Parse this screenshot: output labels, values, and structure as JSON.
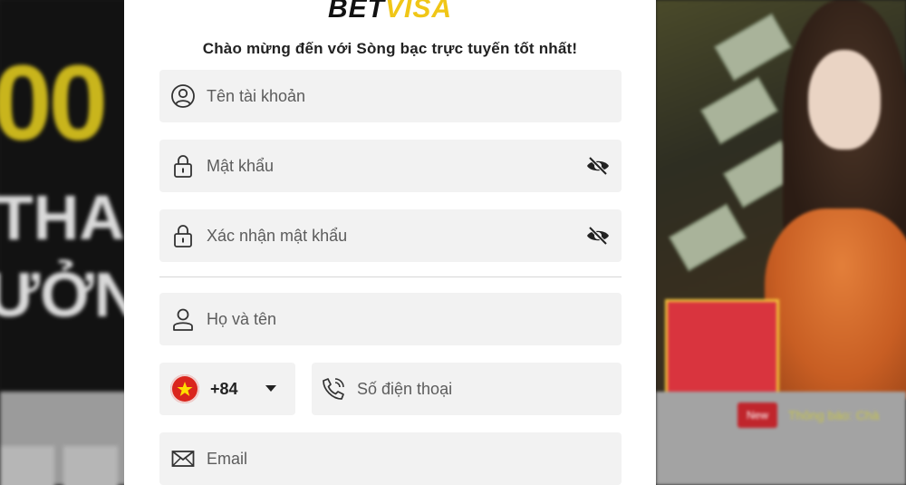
{
  "background": {
    "left_big": "00",
    "left_line1": "THAN",
    "left_line2": "ƯỞN",
    "new_badge": "New",
    "notice_text": "Thông báo: Chà"
  },
  "logo": {
    "part1": "BET",
    "part2": "VISA"
  },
  "welcome": "Chào mừng đến với Sòng bạc trực tuyến tốt nhất!",
  "form": {
    "username_placeholder": "Tên tài khoản",
    "password_placeholder": "Mật khẩu",
    "confirm_password_placeholder": "Xác nhận mật khẩu",
    "fullname_placeholder": "Họ và tên",
    "country_code": "+84",
    "phone_placeholder": "Số điện thoại",
    "email_placeholder": "Email"
  },
  "icons": {
    "username": "user-circle-icon",
    "password": "lock-icon",
    "password_toggle": "eye-off-icon",
    "fullname": "user-icon",
    "flag": "vietnam-flag-icon",
    "dropdown": "caret-down-icon",
    "phone": "phone-icon",
    "email": "envelope-icon"
  },
  "colors": {
    "brand_yellow": "#f0c617",
    "field_bg": "#f2f2f2",
    "text_dark": "#222222",
    "placeholder": "#5c5c5c"
  }
}
